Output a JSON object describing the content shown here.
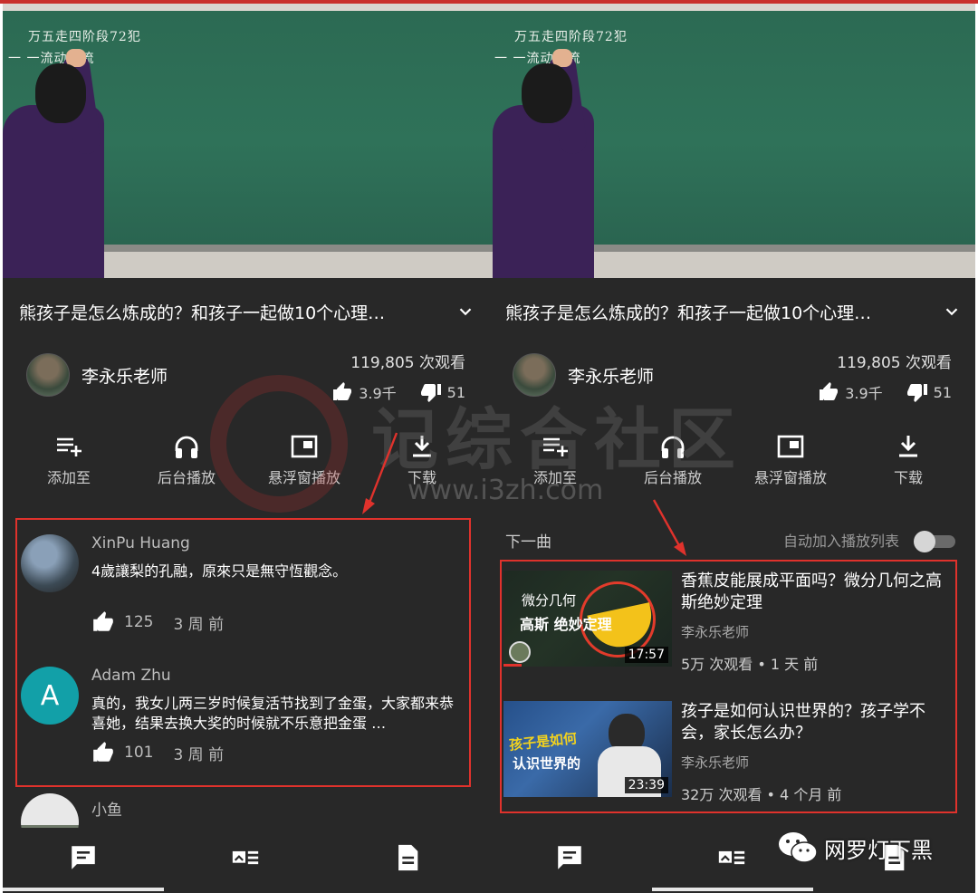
{
  "left": {
    "video": {
      "chalk_line1": "万五走四阶段72犯",
      "chalk_line2": "一 一流动的流"
    },
    "title": "熊孩子是怎么炼成的？和孩子一起做10个心理…",
    "channel": "李永乐老师",
    "views": "119,805 次观看",
    "likes": "3.9千",
    "dislikes": "51",
    "actions": [
      {
        "label": "添加至",
        "icon": "playlist-add-icon"
      },
      {
        "label": "后台播放",
        "icon": "headphones-icon"
      },
      {
        "label": "悬浮窗播放",
        "icon": "picture-in-picture-icon"
      },
      {
        "label": "下载",
        "icon": "download-icon"
      }
    ],
    "comments": [
      {
        "author": "XinPu Huang",
        "text": "4歲讓梨的孔融，原來只是無守恆觀念。",
        "likes": "125",
        "time": "3 周 前"
      },
      {
        "author": "Adam Zhu",
        "avatar_letter": "A",
        "text": "真的，我女儿两三岁时候复活节找到了金蛋，大家都来恭喜她，结果去换大奖的时候就不乐意把金蛋 …",
        "likes": "101",
        "time": "3 周 前"
      },
      {
        "author": "小鱼"
      }
    ]
  },
  "right": {
    "video": {
      "chalk_line1": "万五走四阶段72犯",
      "chalk_line2": "一 一流动的流"
    },
    "title": "熊孩子是怎么炼成的？和孩子一起做10个心理…",
    "channel": "李永乐老师",
    "views": "119,805 次观看",
    "likes": "3.9千",
    "dislikes": "51",
    "actions": [
      {
        "label": "添加至",
        "icon": "playlist-add-icon"
      },
      {
        "label": "后台播放",
        "icon": "headphones-icon"
      },
      {
        "label": "悬浮窗播放",
        "icon": "picture-in-picture-icon"
      },
      {
        "label": "下载",
        "icon": "download-icon"
      }
    ],
    "next_label": "下一曲",
    "autoplay_label": "自动加入播放列表",
    "autoplay_on": false,
    "videos": [
      {
        "title": "香蕉皮能展成平面吗？微分几何之高斯绝妙定理",
        "channel": "李永乐老师",
        "meta": "5万 次观看 • 1 天 前",
        "duration": "17:57",
        "thumb_line1": "微分几何",
        "thumb_line2": "高斯 绝妙定理"
      },
      {
        "title": "孩子是如何认识世界的？孩子学不会，家长怎么办？",
        "channel": "李永乐老师",
        "meta": "32万 次观看 • 4 个月 前",
        "duration": "23:39",
        "thumb_line1": "孩子是如何",
        "thumb_line2": "认识世界的"
      }
    ]
  },
  "watermark": {
    "text": "记综合社区",
    "url": "www.i3zh.com"
  },
  "wechat_label": "网罗灯下黑",
  "colors": {
    "panel_bg": "#282828",
    "annotation_red": "#e0322c",
    "board_green": "#2f7259",
    "accent_red_bar": "#c9302c"
  }
}
